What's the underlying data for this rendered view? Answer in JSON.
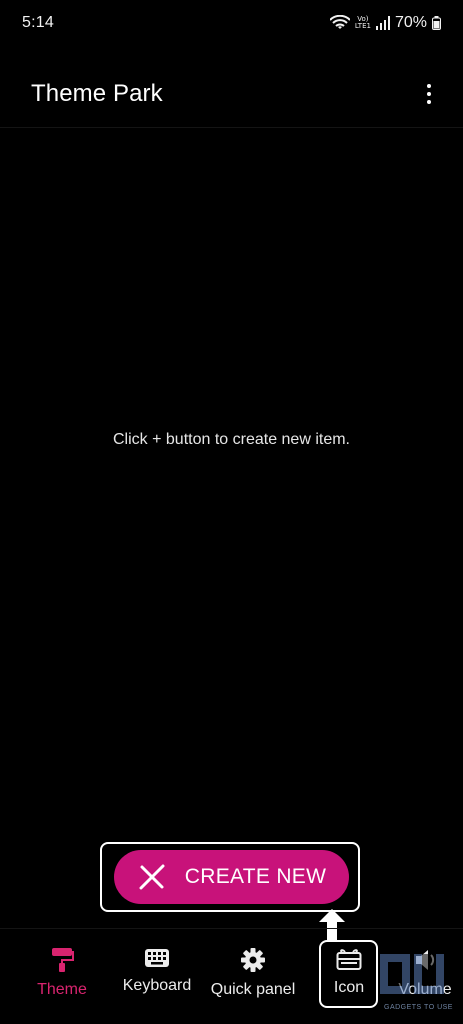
{
  "status_bar": {
    "time": "5:14",
    "volte_top": "Vo)",
    "volte_bottom": "LTE1",
    "battery": "70%"
  },
  "app_bar": {
    "title": "Theme Park",
    "more_icon": "more-vertical-icon"
  },
  "main": {
    "empty_message": "Click + button to create new item."
  },
  "create_button": {
    "label": "CREATE NEW",
    "icon": "plus-icon",
    "color": "#c8127a"
  },
  "bottom_nav": {
    "items": [
      {
        "label": "Theme",
        "icon": "paint-roller-icon",
        "active": true
      },
      {
        "label": "Keyboard",
        "icon": "keyboard-icon",
        "active": false
      },
      {
        "label": "Quick panel",
        "icon": "gear-icon",
        "active": false
      },
      {
        "label": "Icon",
        "icon": "gift-box-icon",
        "active": false
      },
      {
        "label": "Volume",
        "icon": "volume-icon",
        "active": false
      }
    ],
    "active_color": "#d9246f"
  },
  "watermark": {
    "text": "GADGETS TO USE"
  }
}
